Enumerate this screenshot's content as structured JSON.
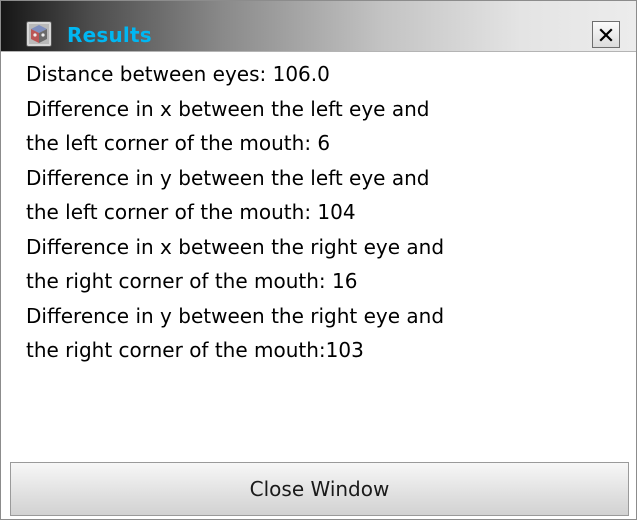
{
  "window": {
    "title": "Results",
    "close_glyph": "✕",
    "icon": "results-app-icon"
  },
  "results": {
    "lines": [
      "Distance between eyes: 106.0",
      "Difference in x between the left eye and",
      "the left corner of the mouth: 6",
      "Difference in y between the left eye and",
      "the left corner of the mouth: 104",
      "Difference in x between the right eye and",
      "the right corner of the mouth: 16",
      "Difference in y between the right eye and",
      "the right corner of the mouth:103"
    ]
  },
  "footer": {
    "close_label": "Close Window"
  },
  "colors": {
    "title_text": "#00b7f2",
    "titlebar_dark": "#161616",
    "titlebar_light": "#ececec"
  }
}
